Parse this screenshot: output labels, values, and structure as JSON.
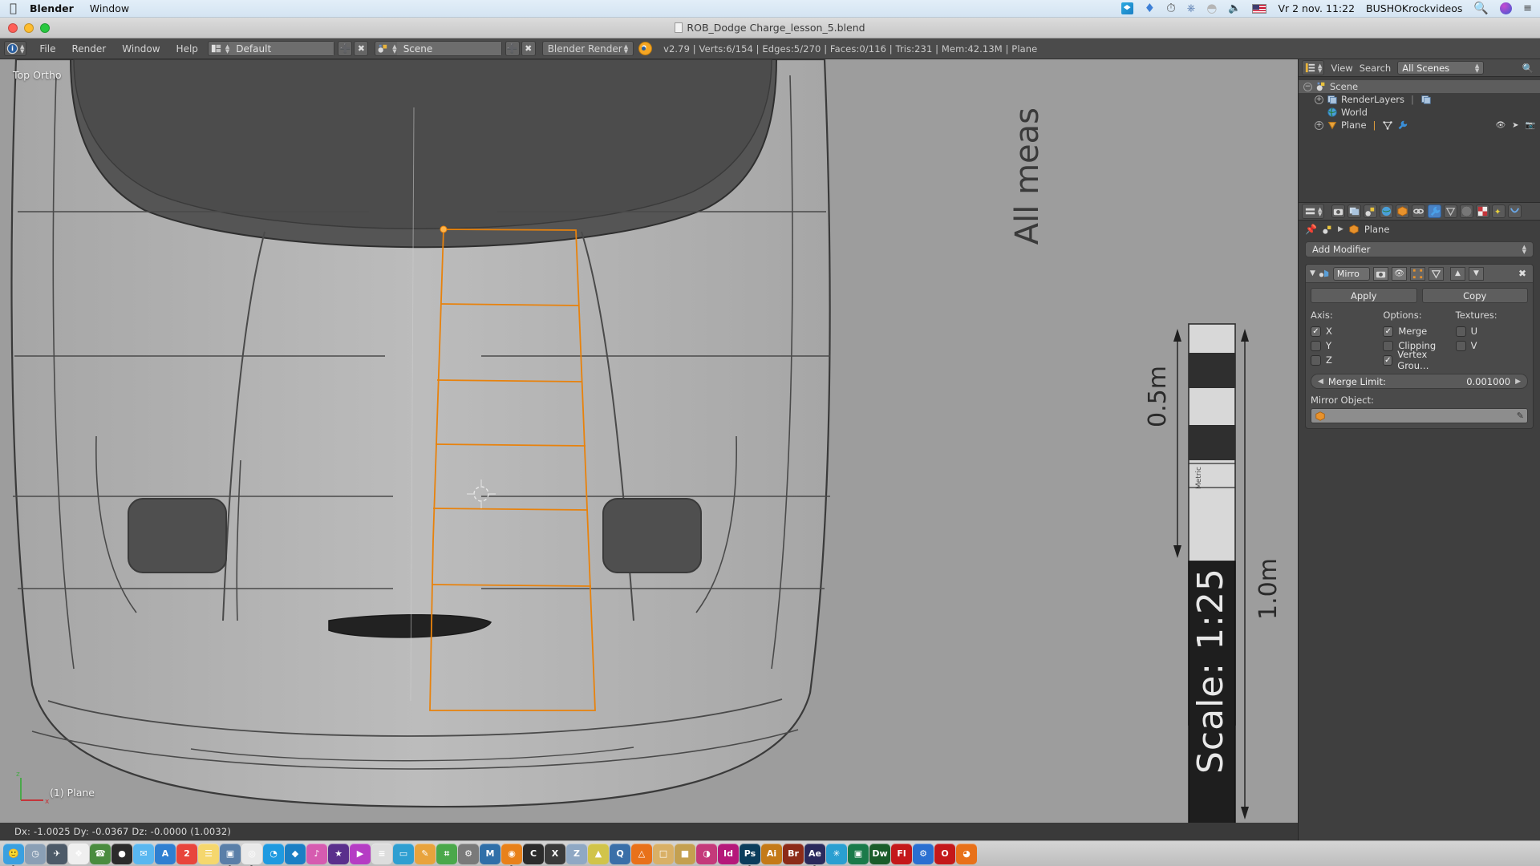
{
  "macbar": {
    "apple_icon": "apple-icon",
    "app_name": "Blender",
    "menus": [
      "Window"
    ],
    "tray_icons": [
      "dropbox-sync-icon",
      "dropbox-icon",
      "time-machine-icon",
      "bluetooth-icon",
      "wifi-off-icon",
      "volume-icon",
      "flag-us-icon"
    ],
    "datetime": "Vr 2 nov.  11:22",
    "user": "BUSHOKrockvideos",
    "right_icons": [
      "search-icon",
      "siri-icon",
      "control-center-icon"
    ]
  },
  "window": {
    "title": "ROB_Dodge Charge_lesson_5.blend"
  },
  "header": {
    "editor_icon": "info-editor-icon",
    "menus": [
      "File",
      "Render",
      "Window",
      "Help"
    ],
    "screen_layout": "Default",
    "scene": "Scene",
    "engine": "Blender Render",
    "stats": "v2.79 | Verts:6/154 | Edges:5/270 | Faces:0/116 | Tris:231 | Mem:42.13M | Plane",
    "stats_parts": {
      "version": "v2.79",
      "verts": "Verts:6/154",
      "edges": "Edges:5/270",
      "faces": "Faces:0/116",
      "tris": "Tris:231",
      "mem": "Mem:42.13M",
      "object": "Plane"
    }
  },
  "viewport": {
    "view_label": "Top Ortho",
    "object_label": "(1) Plane",
    "blueprint": {
      "scale_text": "Scale: 1:25",
      "dim_upper": "0.5m",
      "dim_lower": "1.0m",
      "note": "All meas",
      "tiny_label": "Metric"
    }
  },
  "outliner": {
    "display_mode_icon": "outliner-display-icon",
    "menus": [
      "View",
      "Search"
    ],
    "scope": "All Scenes",
    "search_icon": "magnifier-icon",
    "rows": [
      {
        "label": "Scene",
        "icon": "scene-icon",
        "indent": 0,
        "selected": true,
        "expander": "minus"
      },
      {
        "label": "RenderLayers",
        "icon": "renderlayers-icon",
        "indent": 1,
        "selected": false,
        "expander": "plus"
      },
      {
        "label": "World",
        "icon": "world-icon",
        "indent": 1,
        "selected": false,
        "expander": "none"
      },
      {
        "label": "Plane",
        "icon": "mesh-object-icon",
        "indent": 1,
        "selected": false,
        "expander": "plus"
      }
    ],
    "row_right_icons": [
      "eye-icon",
      "cursor-arrow-icon",
      "render-camera-icon"
    ]
  },
  "properties": {
    "tabs": [
      {
        "name": "render-tab",
        "icon": "camera-icon",
        "active": false
      },
      {
        "name": "render-layers-tab",
        "icon": "images-icon",
        "active": false
      },
      {
        "name": "scene-tab",
        "icon": "scene-icon",
        "active": false
      },
      {
        "name": "world-tab",
        "icon": "world-icon",
        "active": false
      },
      {
        "name": "object-tab",
        "icon": "cube-icon",
        "active": false
      },
      {
        "name": "constraints-tab",
        "icon": "chain-icon",
        "active": false
      },
      {
        "name": "modifiers-tab",
        "icon": "wrench-icon",
        "active": true
      },
      {
        "name": "data-tab",
        "icon": "triangle-mesh-icon",
        "active": false
      },
      {
        "name": "material-tab",
        "icon": "sphere-icon",
        "active": false
      },
      {
        "name": "texture-tab",
        "icon": "checker-icon",
        "active": false
      },
      {
        "name": "particles-tab",
        "icon": "particles-icon",
        "active": false
      },
      {
        "name": "physics-tab",
        "icon": "physics-icon",
        "active": false
      }
    ],
    "breadcrumb": {
      "pin_icon": "pin-icon",
      "scene_icon": "scene-icon",
      "object_icon": "cube-icon",
      "object": "Plane"
    },
    "add_modifier": "Add Modifier",
    "modifier": {
      "icon": "mirror-modifier-icon",
      "name": "Mirro",
      "toggle_icons": [
        "render-visibility-icon",
        "viewport-visibility-icon",
        "edit-mode-icon",
        "cage-icon"
      ],
      "move_up_icon": "chevron-up-icon",
      "move_down_icon": "chevron-down-icon",
      "delete_icon": "x-close-icon",
      "apply_label": "Apply",
      "copy_label": "Copy",
      "col_headers": [
        "Axis:",
        "Options:",
        "Textures:"
      ],
      "axis": [
        {
          "label": "X",
          "checked": true
        },
        {
          "label": "Y",
          "checked": false
        },
        {
          "label": "Z",
          "checked": false
        }
      ],
      "options": [
        {
          "label": "Merge",
          "checked": true
        },
        {
          "label": "Clipping",
          "checked": false
        },
        {
          "label": "Vertex Grou…",
          "checked": true
        }
      ],
      "textures": [
        {
          "label": "U",
          "checked": false
        },
        {
          "label": "V",
          "checked": false
        }
      ],
      "merge_limit_label": "Merge Limit:",
      "merge_limit_value": "0.001000",
      "mirror_object_label": "Mirror Object:",
      "mirror_object_value": "",
      "eyedropper_icon": "eyedropper-icon"
    }
  },
  "status": {
    "transform": "Dx: -1.0025   Dy: -0.0367  Dz: -0.0000 (1.0032)"
  },
  "dock": {
    "icons": [
      {
        "name": "finder",
        "color": "#3aa0e0",
        "glyph": "🙂",
        "running": true
      },
      {
        "name": "launchpad",
        "color": "#8a9fb5",
        "glyph": "◷",
        "running": false
      },
      {
        "name": "mission-control",
        "color": "#4d5a68",
        "glyph": "✈",
        "running": false
      },
      {
        "name": "photos",
        "color": "#efefef",
        "glyph": "❖",
        "running": false
      },
      {
        "name": "contacts",
        "color": "#4a8c3f",
        "glyph": "☎",
        "running": false
      },
      {
        "name": "dvd-player",
        "color": "#2b2b2b",
        "glyph": "●",
        "running": false
      },
      {
        "name": "mail",
        "color": "#59b7f0",
        "glyph": "✉",
        "running": false
      },
      {
        "name": "app-store",
        "color": "#2f7fd1",
        "glyph": "A",
        "running": false
      },
      {
        "name": "calendar",
        "color": "#e8453c",
        "glyph": "2",
        "running": false
      },
      {
        "name": "notes",
        "color": "#f5d76e",
        "glyph": "☰",
        "running": false
      },
      {
        "name": "preview",
        "color": "#5a7fa8",
        "glyph": "▣",
        "running": true
      },
      {
        "name": "chrome",
        "color": "#e9e9e9",
        "glyph": "◎",
        "running": true
      },
      {
        "name": "safari",
        "color": "#1f9ae0",
        "glyph": "◔",
        "running": false
      },
      {
        "name": "dropbox",
        "color": "#1b7fc4",
        "glyph": "◆",
        "running": false
      },
      {
        "name": "itunes",
        "color": "#d65bb0",
        "glyph": "♪",
        "running": false
      },
      {
        "name": "imovie",
        "color": "#5a2f8c",
        "glyph": "★",
        "running": false
      },
      {
        "name": "final-cut",
        "color": "#b53cc4",
        "glyph": "▶",
        "running": false
      },
      {
        "name": "text-editor",
        "color": "#dddddd",
        "glyph": "≡",
        "running": false
      },
      {
        "name": "keynote",
        "color": "#2f9fd1",
        "glyph": "▭",
        "running": false
      },
      {
        "name": "pages",
        "color": "#e8a33c",
        "glyph": "✎",
        "running": false
      },
      {
        "name": "numbers",
        "color": "#4aa84a",
        "glyph": "⌗",
        "running": false
      },
      {
        "name": "system-prefs",
        "color": "#7a7a7a",
        "glyph": "⚙",
        "running": false
      },
      {
        "name": "maya",
        "color": "#2f6fa8",
        "glyph": "M",
        "running": false
      },
      {
        "name": "blender",
        "color": "#e8811a",
        "glyph": "◉",
        "running": true
      },
      {
        "name": "cinema4d",
        "color": "#2b2b2b",
        "glyph": "C",
        "running": false
      },
      {
        "name": "xtools",
        "color": "#3a3a3a",
        "glyph": "X",
        "running": false
      },
      {
        "name": "zbrush",
        "color": "#8fa8c4",
        "glyph": "Z",
        "running": false
      },
      {
        "name": "sculpt",
        "color": "#d1c44a",
        "glyph": "▲",
        "running": false
      },
      {
        "name": "quicktime",
        "color": "#3a6fa8",
        "glyph": "Q",
        "running": false
      },
      {
        "name": "vlc",
        "color": "#e8711a",
        "glyph": "△",
        "running": false
      },
      {
        "name": "folder-docs",
        "color": "#d9b066",
        "glyph": "□",
        "running": false
      },
      {
        "name": "folder-work",
        "color": "#c4a050",
        "glyph": "■",
        "running": false
      },
      {
        "name": "color-wheel",
        "color": "#c43a7a",
        "glyph": "◑",
        "running": false
      },
      {
        "name": "indesign",
        "color": "#b5187a",
        "glyph": "Id",
        "running": false
      },
      {
        "name": "photoshop",
        "color": "#0b3d5c",
        "glyph": "Ps",
        "running": true
      },
      {
        "name": "illustrator",
        "color": "#c47a18",
        "glyph": "Ai",
        "running": false
      },
      {
        "name": "bridge",
        "color": "#8c2b18",
        "glyph": "Br",
        "running": false
      },
      {
        "name": "after-effects",
        "color": "#2a2a5c",
        "glyph": "Ae",
        "running": true
      },
      {
        "name": "premiere",
        "color": "#2a9fd1",
        "glyph": "✳",
        "running": false
      },
      {
        "name": "media-encoder",
        "color": "#1a7a4a",
        "glyph": "▣",
        "running": false
      },
      {
        "name": "dreamweaver",
        "color": "#1a5c2a",
        "glyph": "Dw",
        "running": false
      },
      {
        "name": "flash",
        "color": "#c4181a",
        "glyph": "Fl",
        "running": false
      },
      {
        "name": "creative-cloud",
        "color": "#2a6fd1",
        "glyph": "⚙",
        "running": false
      },
      {
        "name": "opera",
        "color": "#c4181a",
        "glyph": "O",
        "running": false
      },
      {
        "name": "firefox",
        "color": "#e8711a",
        "glyph": "◕",
        "running": false
      }
    ]
  }
}
